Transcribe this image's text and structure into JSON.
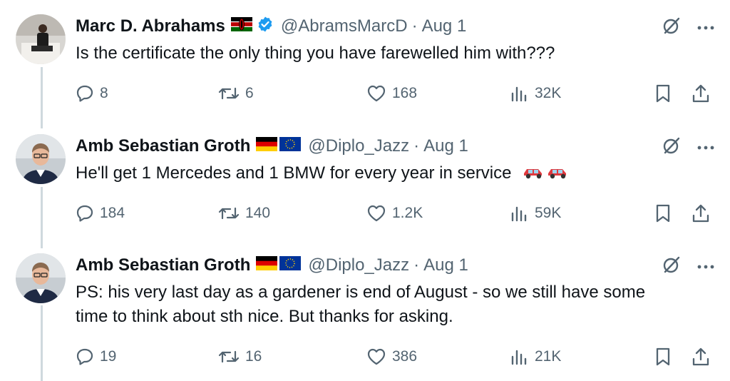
{
  "tweets": [
    {
      "name": "Marc D. Abrahams",
      "handle": "@AbramsMarcD",
      "separator": "·",
      "date": "Aug 1",
      "verified": true,
      "flags": [
        "kenya-flag"
      ],
      "text_lines": [
        "Is the certificate the only thing you have farewelled him with???"
      ],
      "replies": "8",
      "retweets": "6",
      "likes": "168",
      "views": "32K"
    },
    {
      "name": "Amb Sebastian Groth",
      "handle": "@Diplo_Jazz",
      "separator": "·",
      "date": "Aug 1",
      "verified": false,
      "flags": [
        "germany-flag",
        "eu-flag"
      ],
      "text_lines": [
        "He'll get 1 Mercedes and 1 BMW for every year in service"
      ],
      "emoji": [
        "car-emoji",
        "car-emoji"
      ],
      "replies": "184",
      "retweets": "140",
      "likes": "1.2K",
      "views": "59K"
    },
    {
      "name": "Amb Sebastian Groth",
      "handle": "@Diplo_Jazz",
      "separator": "·",
      "date": "Aug 1",
      "verified": false,
      "flags": [
        "germany-flag",
        "eu-flag"
      ],
      "text_lines": [
        "PS: his very last day as a gardener is end of August - so we still have some",
        "time to think about sth nice. But thanks for asking."
      ],
      "replies": "19",
      "retweets": "16",
      "likes": "386",
      "views": "21K"
    }
  ],
  "colors": {
    "text": "#0f1419",
    "secondary": "#536471",
    "verified": "#1d9bf0",
    "thread_line": "#cfd9de"
  }
}
